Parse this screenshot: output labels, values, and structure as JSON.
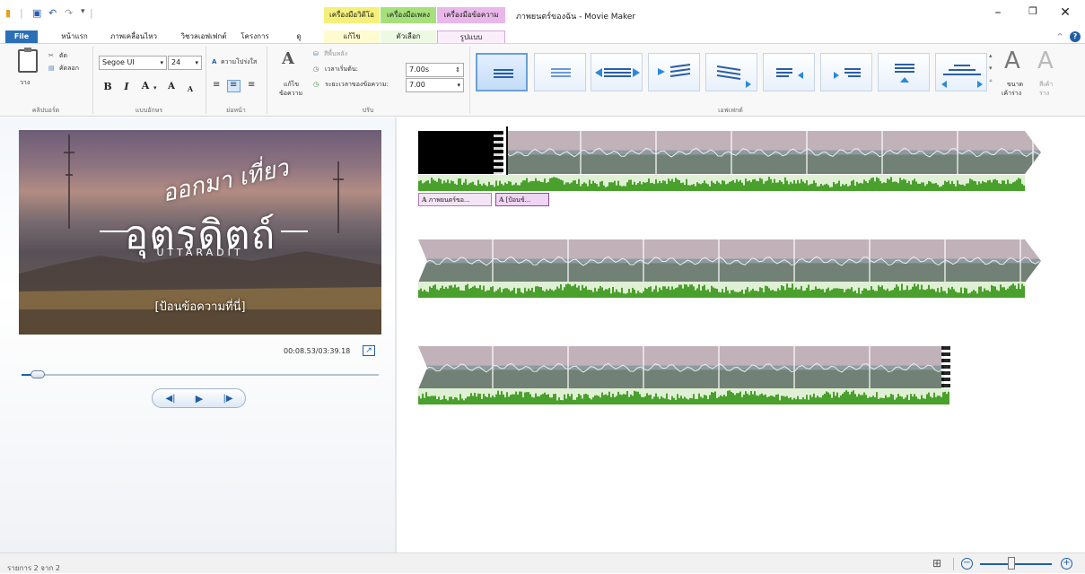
{
  "titlebar": {
    "title": "ภาพยนตร์ของฉัน - Movie Maker",
    "context_groups": [
      {
        "label": "เครื่องมือวิดีโอ",
        "color": "#f5f07a"
      },
      {
        "label": "เครื่องมือเพลง",
        "color": "#a6e07a"
      },
      {
        "label": "เครื่องมือข้อความ",
        "color": "#e9b7ea"
      }
    ],
    "window_buttons": [
      "–",
      "❐",
      "✕"
    ]
  },
  "tabs": [
    {
      "label": "File"
    },
    {
      "label": "หน้าแรก"
    },
    {
      "label": "ภาพเคลื่อนไหว"
    },
    {
      "label": "วิชวลเอฟเฟกต์"
    },
    {
      "label": "โครงการ"
    },
    {
      "label": "ดู"
    },
    {
      "label": "แก้ไข"
    },
    {
      "label": "ตัวเลือก"
    },
    {
      "label": "รูปแบบ",
      "active": true
    }
  ],
  "ribbon": {
    "clipboard": {
      "paste": "วาง",
      "cut": "ตัด",
      "copy": "คัดลอก",
      "group": "คลิปบอร์ด"
    },
    "font": {
      "family": "Segoe UI",
      "size": "24",
      "group": "แบบอักษร",
      "bold": "B",
      "italic": "I",
      "color": "A",
      "grow": "A",
      "shrink": "A"
    },
    "paragraph": {
      "transparency": "ความโปร่งใส",
      "group": "ย่อหน้า"
    },
    "adjust": {
      "edit_text": "แก้ไข",
      "edit_text2": "ข้อความ",
      "bg_color": "สีพื้นหลัง",
      "start_time_label": "เวลาเริ่มต้น:",
      "start_time": "7.00s",
      "duration_label": "ระยะเวลาของข้อความ:",
      "duration": "7.00",
      "group": "ปรับ"
    },
    "effects": {
      "group": "เอฟเฟกต์",
      "outline_size": "ขนาด",
      "outline_size2": "เค้าร่าง",
      "outline_color": "สีเค้า",
      "outline_color2": "ร่าง"
    }
  },
  "preview": {
    "line1": "ออกมา เที่ยว",
    "line2": "อุตรดิตถ์",
    "line3": "UTTARADIT",
    "caption": "[ป้อนข้อความที่นี่]",
    "timecode": "00:08.53/03:39.18",
    "seek_fraction": 0.04
  },
  "storyboard": {
    "caption_chips": [
      {
        "text": "ภาพยนตร์ขอ..."
      },
      {
        "text": "[ป้อนข้..."
      }
    ]
  },
  "status": {
    "items": "รายการ 2 จาก 2"
  },
  "colors": {
    "file_tab": "#2b6fb8",
    "accent": "#1f5fa8",
    "waveform": "#4aa02c"
  }
}
